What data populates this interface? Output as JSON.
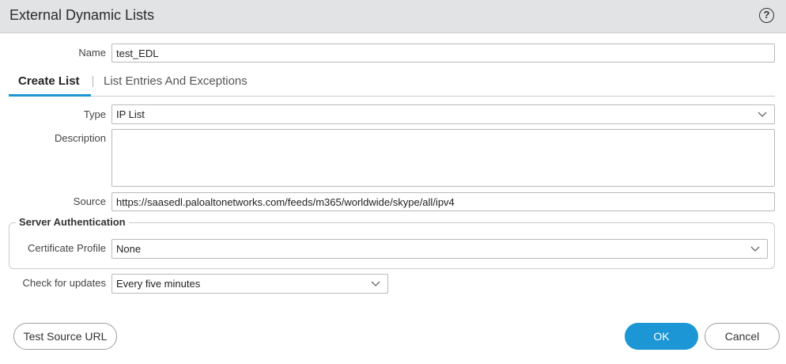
{
  "dialog": {
    "title": "External Dynamic Lists",
    "help_icon": "?"
  },
  "name_field": {
    "label": "Name",
    "value": "test_EDL"
  },
  "tabs": [
    {
      "label": "Create List",
      "active": true
    },
    {
      "label": "List Entries And Exceptions",
      "active": false
    }
  ],
  "type_field": {
    "label": "Type",
    "value": "IP List"
  },
  "description_field": {
    "label": "Description",
    "value": ""
  },
  "source_field": {
    "label": "Source",
    "value": "https://saasedl.paloaltonetworks.com/feeds/m365/worldwide/skype/all/ipv4"
  },
  "server_auth": {
    "legend": "Server Authentication",
    "certificate_profile": {
      "label": "Certificate Profile",
      "value": "None"
    }
  },
  "check_updates": {
    "label": "Check for updates",
    "value": "Every five minutes"
  },
  "buttons": {
    "test_source": "Test Source URL",
    "ok": "OK",
    "cancel": "Cancel"
  },
  "colors": {
    "accent": "#1c96d4",
    "titlebar": "#e1e3e5",
    "border": "#b7b9bc"
  }
}
